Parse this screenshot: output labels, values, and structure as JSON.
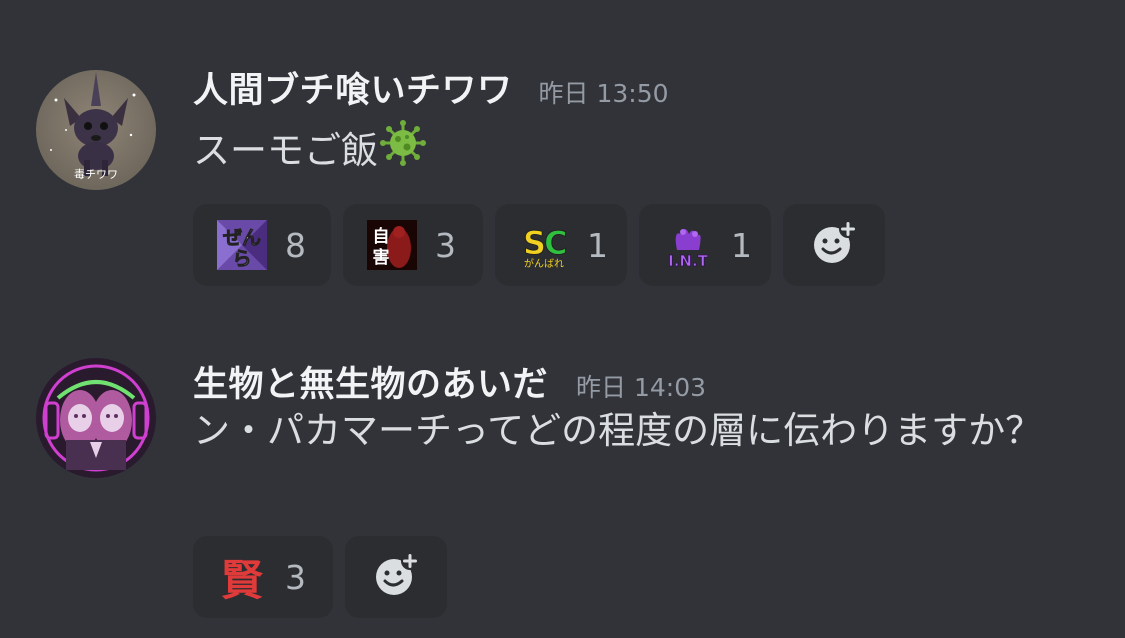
{
  "messages": [
    {
      "username": "人間ブチ喰いチワワ",
      "timestamp": "昨日 13:50",
      "avatar_caption": "毒チワワ",
      "content": "スーモご飯",
      "content_emoji": "virus-icon",
      "reactions": [
        {
          "emoji": "zenra-custom-emoji",
          "label": "ぜんら",
          "count": "8"
        },
        {
          "emoji": "jigai-custom-emoji",
          "label": "自害",
          "count": "3"
        },
        {
          "emoji": "sc-ganbare-custom-emoji",
          "label": "SC",
          "sublabel": "がんばれ",
          "count": "1"
        },
        {
          "emoji": "int-custom-emoji",
          "label": "INT",
          "count": "1"
        }
      ]
    },
    {
      "username": "生物と無生物のあいだ",
      "timestamp": "昨日 14:03",
      "content": "ン・パカマーチってどの程度の層に伝わりますか？",
      "reactions": [
        {
          "emoji": "ken-custom-emoji",
          "label": "賢",
          "count": "3"
        }
      ]
    }
  ],
  "colors": {
    "background": "#313338",
    "reaction_bg": "#2b2d31",
    "username": "#f2f3f5",
    "timestamp": "#949ba4",
    "text": "#dbdee1"
  }
}
